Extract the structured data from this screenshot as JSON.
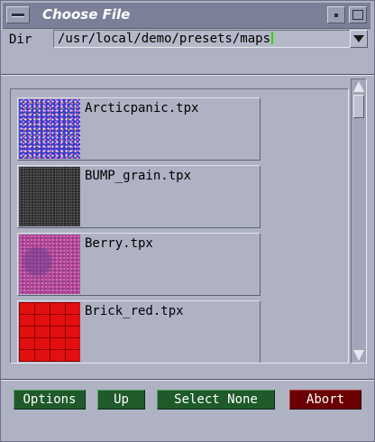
{
  "window": {
    "title": "Choose File"
  },
  "dir": {
    "label": "Dir",
    "value": "/usr/local/demo/presets/maps"
  },
  "files": [
    {
      "name": "Arcticpanic.tpx",
      "thumb": "arctic"
    },
    {
      "name": "BUMP_grain.tpx",
      "thumb": "bump"
    },
    {
      "name": "Berry.tpx",
      "thumb": "berry"
    },
    {
      "name": "Brick_red.tpx",
      "thumb": "brick"
    }
  ],
  "buttons": {
    "options": "Options",
    "up": "Up",
    "select_none": "Select None",
    "abort": "Abort"
  },
  "colors": {
    "title_bar": "#7b8098",
    "background": "#aeb2c3",
    "button_green": "#1f5a2b",
    "button_red": "#6a0000",
    "caret": "#2fd600"
  },
  "icons": {
    "window_menu": "window-menu-icon",
    "minimize": "minimize-icon",
    "maximize": "maximize-icon",
    "dir_dropdown": "chevron-down-icon",
    "scroll_up": "scroll-up-icon",
    "scroll_down": "scroll-down-icon"
  }
}
